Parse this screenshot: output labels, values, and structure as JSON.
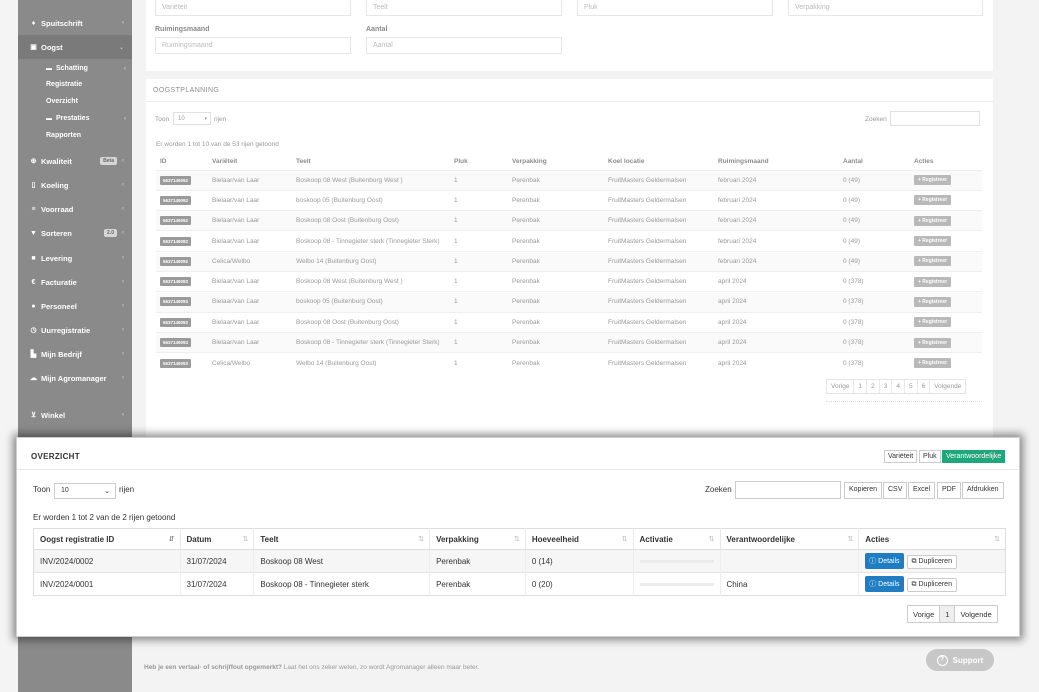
{
  "sidebar": {
    "items": [
      {
        "label": "Spuitschrift",
        "icon": "drop-icon"
      },
      {
        "label": "Oogst",
        "icon": "basket-icon"
      },
      {
        "label": "Kwaliteit",
        "icon": "quality-icon",
        "badge": "Beta"
      },
      {
        "label": "Koeling",
        "icon": "thermometer-icon"
      },
      {
        "label": "Voorraad",
        "icon": "list-icon"
      },
      {
        "label": "Sorteren",
        "icon": "filter-icon",
        "badge": "2.0"
      },
      {
        "label": "Levering",
        "icon": "truck-icon"
      },
      {
        "label": "Facturatie",
        "icon": "euro-icon"
      },
      {
        "label": "Personeel",
        "icon": "user-icon"
      },
      {
        "label": "Uurregistratie",
        "icon": "clock-icon"
      },
      {
        "label": "Mijn Bedrijf",
        "icon": "building-icon"
      },
      {
        "label": "Mijn Agromanager",
        "icon": "cloud-icon"
      },
      {
        "label": "Winkel",
        "icon": "cart-icon"
      }
    ],
    "sub": [
      {
        "label": "Schatting",
        "icon": "folder-icon"
      },
      {
        "label": "Registratie"
      },
      {
        "label": "Overzicht"
      },
      {
        "label": "Prestaties",
        "icon": "folder-icon"
      },
      {
        "label": "Rapporten"
      }
    ]
  },
  "form": {
    "row1": [
      "Variëteit",
      "Teelt",
      "Pluk",
      "Verpakking"
    ],
    "ruimingsmaand_label": "Ruimingsmaand",
    "ruimingsmaand_placeholder": "Ruimingsmaand",
    "aantal_label": "Aantal",
    "aantal_placeholder": "Aantal"
  },
  "planning": {
    "title": "OOGSTPLANNING",
    "show_prefix": "Toon",
    "show_value": "10",
    "show_suffix": "rijen",
    "search_label": "Zoeken",
    "info": "Er worden 1 tot 10 van de 53 rijen getoond",
    "columns": [
      "ID",
      "Variëteit",
      "Teelt",
      "Pluk",
      "Verpakking",
      "Koel locatie",
      "Ruimingsmaand",
      "Aantal",
      "Acties"
    ],
    "register_label": "+ Registreer",
    "rows": [
      {
        "id": "5637149092",
        "var": "Bielaar/van Laar",
        "teelt": "Boskoop 08 West (Buitenburg West )",
        "pluk": "1",
        "verp": "Perenbak",
        "koel": "FruitMasters Geldermalsen",
        "maand": "februari 2024",
        "aantal": "0 (49)"
      },
      {
        "id": "5637149092",
        "var": "Bielaar/van Laar",
        "teelt": "boskoop 05 (Buitenburg Oost)",
        "pluk": "1",
        "verp": "Perenbak",
        "koel": "FruitMasters Geldermalsen",
        "maand": "februari 2024",
        "aantal": "0 (49)"
      },
      {
        "id": "5637149092",
        "var": "Bielaar/van Laar",
        "teelt": "Boskoop 08 Oost (Buitenburg Oost)",
        "pluk": "1",
        "verp": "Perenbak",
        "koel": "FruitMasters Geldermalsen",
        "maand": "februari 2024",
        "aantal": "0 (49)"
      },
      {
        "id": "5637149092",
        "var": "Bielaar/van Laar",
        "teelt": "Boskoop 08 - Tinnegieter sterk (Tinnegieter Sterk)",
        "pluk": "1",
        "verp": "Perenbak",
        "koel": "FruitMasters Geldermalsen",
        "maand": "februari 2024",
        "aantal": "0 (49)"
      },
      {
        "id": "5637149092",
        "var": "Celica/Welbo",
        "teelt": "Welbo 14 (Buitenburg Oost)",
        "pluk": "1",
        "verp": "Perenbak",
        "koel": "FruitMasters Geldermalsen",
        "maand": "februari 2024",
        "aantal": "0 (49)"
      },
      {
        "id": "5637149093",
        "var": "Bielaar/van Laar",
        "teelt": "Boskoop 08 West (Buitenburg West )",
        "pluk": "1",
        "verp": "Perenbak",
        "koel": "FruitMasters Geldermalsen",
        "maand": "april 2024",
        "aantal": "0 (378)"
      },
      {
        "id": "5637149093",
        "var": "Bielaar/van Laar",
        "teelt": "boskoop 05 (Buitenburg Oost)",
        "pluk": "1",
        "verp": "Perenbak",
        "koel": "FruitMasters Geldermalsen",
        "maand": "april 2024",
        "aantal": "0 (378)"
      },
      {
        "id": "5637149093",
        "var": "Bielaar/van Laar",
        "teelt": "Boskoop 08 Oost (Buitenburg Oost)",
        "pluk": "1",
        "verp": "Perenbak",
        "koel": "FruitMasters Geldermalsen",
        "maand": "april 2024",
        "aantal": "0 (378)"
      },
      {
        "id": "5637149093",
        "var": "Bielaar/van Laar",
        "teelt": "Boskoop 08 - Tinnegieter sterk (Tinnegieter Sterk)",
        "pluk": "1",
        "verp": "Perenbak",
        "koel": "FruitMasters Geldermalsen",
        "maand": "april 2024",
        "aantal": "0 (378)"
      },
      {
        "id": "5637149093",
        "var": "Celica/Welbo",
        "teelt": "Welbo 14 (Buitenburg Oost)",
        "pluk": "1",
        "verp": "Perenbak",
        "koel": "FruitMasters Geldermalsen",
        "maand": "april 2024",
        "aantal": "0 (378)"
      }
    ],
    "pager": [
      "Vorige",
      "1",
      "2",
      "3",
      "4",
      "5",
      "6",
      "Volgende"
    ]
  },
  "overview": {
    "title": "OVERZICHT",
    "toggles": [
      "Variëteit",
      "Pluk",
      "Verantwoordelijke"
    ],
    "show_prefix": "Toon",
    "show_value": "10",
    "show_suffix": "rijen",
    "search_label": "Zoeken",
    "export_buttons": [
      "Kopieren",
      "CSV",
      "Excel",
      "PDF",
      "Afdrukken"
    ],
    "info": "Er worden 1 tot 2 van de 2 rijen getoond",
    "columns": [
      "Oogst registratie ID",
      "Datum",
      "Teelt",
      "Verpakking",
      "Hoeveelheid",
      "Activatie",
      "Verantwoordelijke",
      "Acties"
    ],
    "details_label": "Details",
    "duplicate_label": "Dupliceren",
    "rows": [
      {
        "id": "INV/2024/0002",
        "datum": "31/07/2024",
        "teelt": "Boskoop 08 West",
        "verp": "Perenbak",
        "hoev": "0 (14)",
        "verantw": ""
      },
      {
        "id": "INV/2024/0001",
        "datum": "31/07/2024",
        "teelt": "Boskoop 08 - Tinnegieter sterk",
        "verp": "Perenbak",
        "hoev": "0 (20)",
        "verantw": "China"
      }
    ],
    "pager": [
      "Vorige",
      "1",
      "Volgende"
    ]
  },
  "footer": {
    "bold": "Heb je een vertaal- of schrijffout opgemerkt?",
    "rest": " Laat het ons zeker weten, zo wordt Agromanager alleen maar beter."
  },
  "support_label": "Support",
  "colors": {
    "accent": "#1fa67a",
    "details": "#1f7ec3",
    "sidebar": "#8a8a8a"
  }
}
